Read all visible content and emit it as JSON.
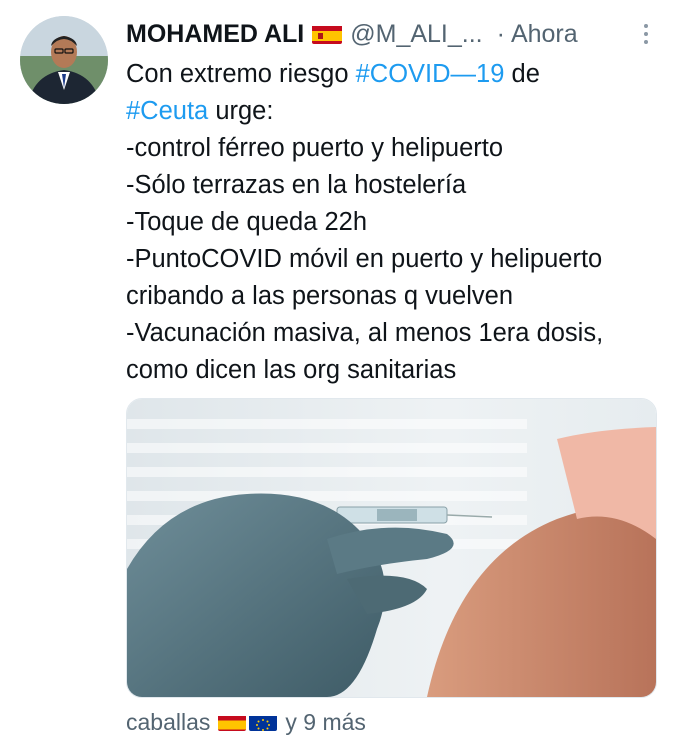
{
  "tweet": {
    "author_name": "MOHAMED ALI",
    "handle": "@M_ALI_...",
    "separator": "·",
    "time": "Ahora",
    "text_prefix": "Con extremo riesgo ",
    "hashtag_covid": "#COVID—19",
    "text_mid": " de",
    "hashtag_ceuta": "#Ceuta",
    "text_body": " urge:\n-control férreo puerto y helipuerto\n-Sólo terrazas en la hostelería\n-Toque de queda 22h\n-PuntoCOVID móvil en puerto y helipuerto cribando a las personas q vuelven\n-Vacunación masiva, al menos 1era dosis, como dicen las org sanitarias",
    "hashtag_color": "#1d9bf0",
    "flag_icon": "spain-flag-icon"
  },
  "footer": {
    "liked_by": "caballas",
    "flags": [
      "spain-flag-icon",
      "eu-flag-icon"
    ],
    "more_text": "y 9 más"
  }
}
